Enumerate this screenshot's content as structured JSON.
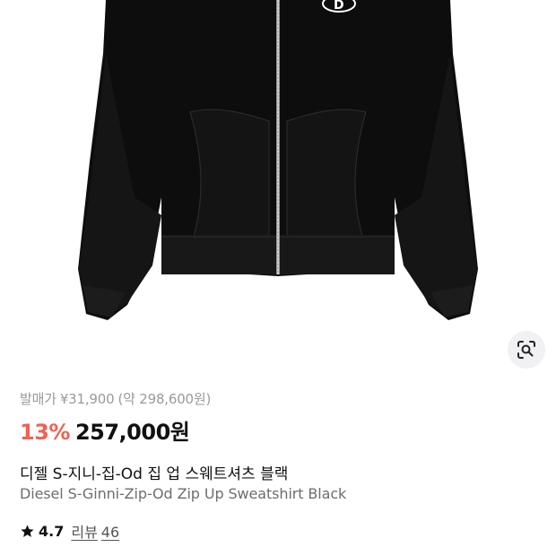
{
  "product": {
    "release_label": "발매가",
    "release_price": "¥31,900",
    "release_price_converted": "(약 298,600원)",
    "discount": "13%",
    "price": "257,000원",
    "name_ko": "디젤 S-지니-집-Od 집 업 스웨트셔츠 블랙",
    "name_en": "Diesel S-Ginni-Zip-Od Zip Up Sweatshirt Black",
    "rating": "4.7",
    "review_label": "리뷰",
    "review_count": "46"
  },
  "image": {
    "alt": "product-photo-black-zip-up-hoodie",
    "logo_letter": "D"
  },
  "colors": {
    "discount": "#ef6253",
    "garment": "#0d0d0d",
    "zipper": "#b9b9b9"
  },
  "icons": {
    "lens": "image-search-icon",
    "star": "star-icon"
  }
}
